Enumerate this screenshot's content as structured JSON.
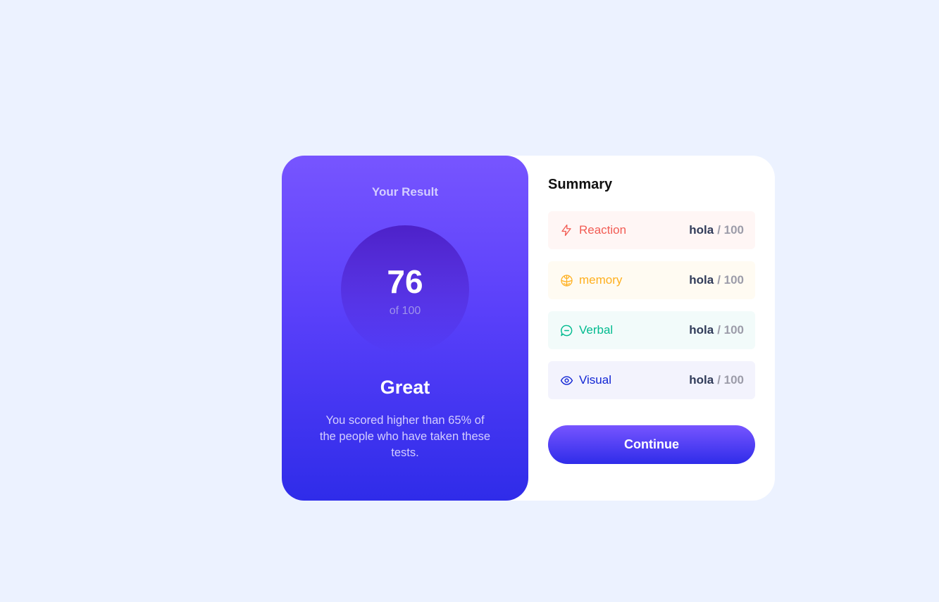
{
  "result": {
    "heading": "Your Result",
    "score": "76",
    "score_of": "of 100",
    "rating": "Great",
    "description": "You scored higher than 65% of the people who have taken these tests."
  },
  "summary": {
    "title": "Summary",
    "items": [
      {
        "label": "Reaction",
        "icon": "lightning-icon",
        "score": "hola",
        "max": "/ 100",
        "color": "#f25c54",
        "bg": "#fff6f5"
      },
      {
        "label": "memory",
        "icon": "brain-icon",
        "score": "hola",
        "max": "/ 100",
        "color": "#ffb01f",
        "bg": "#fffbf2"
      },
      {
        "label": "Verbal",
        "icon": "chat-bubble-icon",
        "score": "hola",
        "max": "/ 100",
        "color": "#00bb8f",
        "bg": "#f2fbfa"
      },
      {
        "label": "Visual",
        "icon": "eye-icon",
        "score": "hola",
        "max": "/ 100",
        "color": "#1125d4",
        "bg": "#f3f3fd"
      }
    ],
    "continue_label": "Continue"
  },
  "colors": {
    "page_bg": "#ecf2ff",
    "gradient_top": "#7755ff",
    "gradient_bottom": "#2f2ce9"
  }
}
